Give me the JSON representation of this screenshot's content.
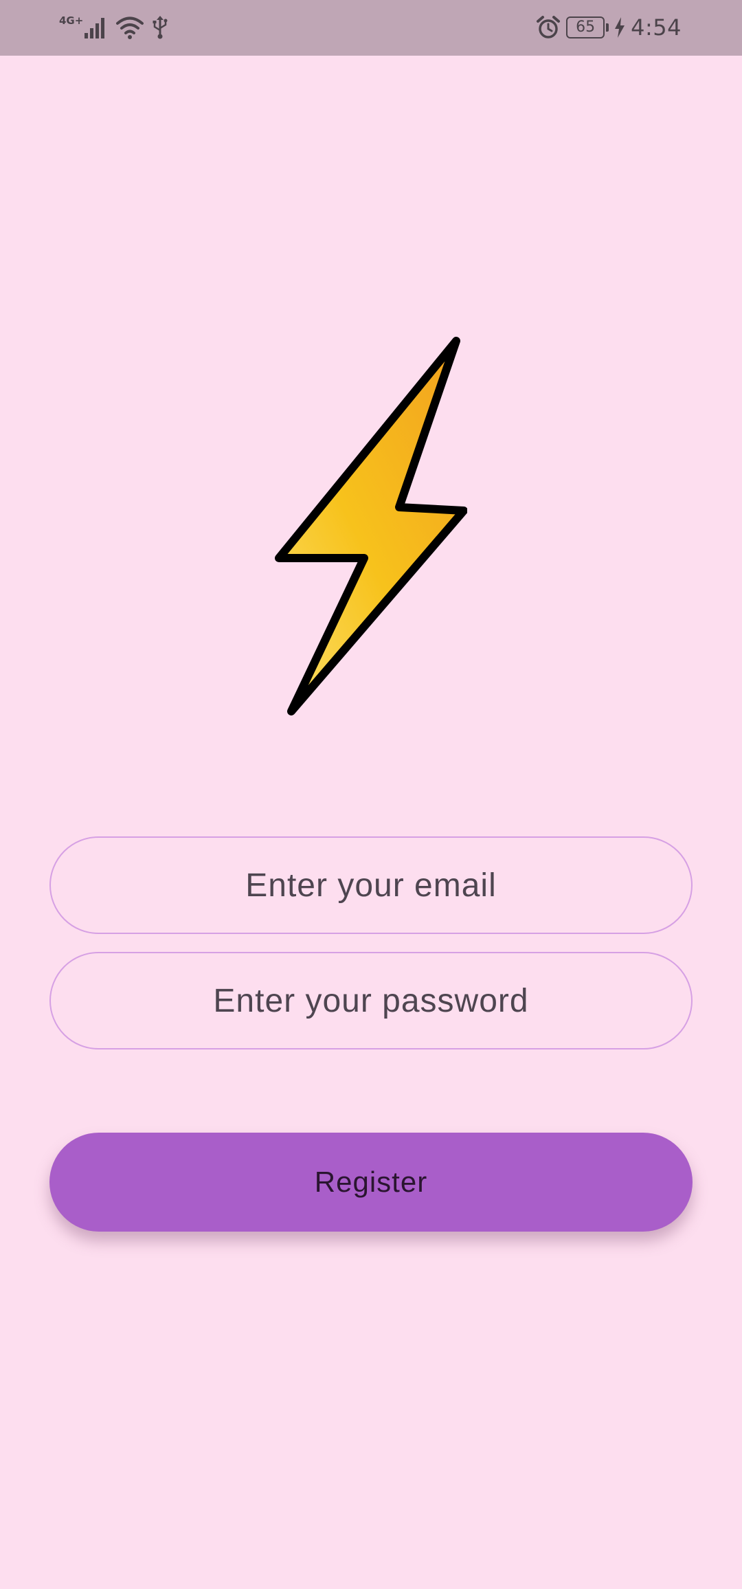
{
  "status_bar": {
    "network_label": "4G+",
    "battery_level": "65",
    "time": "4:54",
    "icons": [
      "signal-icon",
      "wifi-icon",
      "usb-icon",
      "alarm-icon",
      "battery-icon",
      "charging-icon"
    ]
  },
  "logo": {
    "icon": "lightning-bolt-icon",
    "colors": {
      "fill_light": "#FCE06A",
      "fill_mid": "#F7C21C",
      "fill_dark": "#F2A11F",
      "outline": "#000000"
    }
  },
  "form": {
    "email_placeholder": "Enter your email",
    "email_value": "",
    "password_placeholder": "Enter your password",
    "password_value": "",
    "register_label": "Register"
  },
  "colors": {
    "background": "#FDDEEF",
    "status_bar": "#BFA6B5",
    "field_border": "#D6A0E4",
    "accent": "#A95EC9"
  }
}
